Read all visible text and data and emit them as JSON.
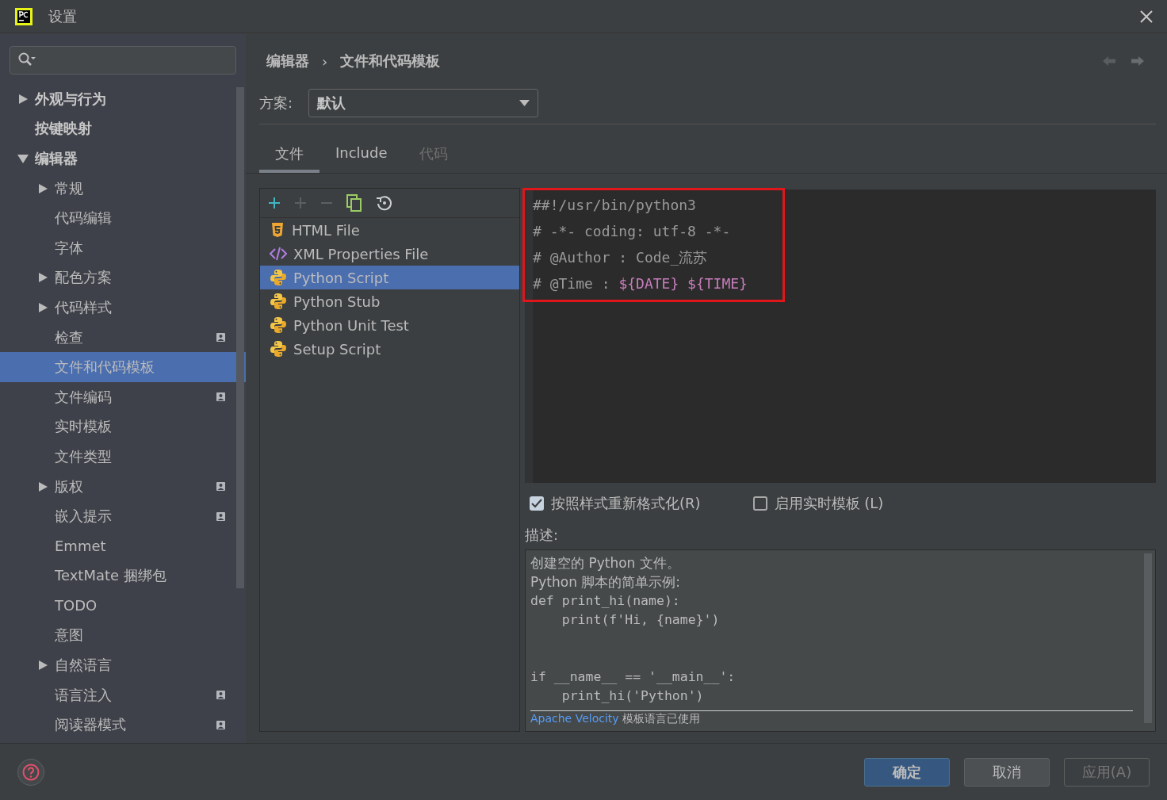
{
  "window": {
    "title": "设置"
  },
  "sidebar": {
    "items": [
      {
        "label": "外观与行为",
        "expanded": false,
        "bold": true,
        "selected": false
      },
      {
        "label": "按键映射",
        "bold": true,
        "selected": false
      },
      {
        "label": "编辑器",
        "expanded": true,
        "bold": true,
        "selected": false,
        "children": [
          {
            "label": "常规",
            "expanded": false,
            "selected": false
          },
          {
            "label": "代码编辑",
            "selected": false
          },
          {
            "label": "字体",
            "selected": false
          },
          {
            "label": "配色方案",
            "expanded": false,
            "selected": false
          },
          {
            "label": "代码样式",
            "expanded": false,
            "selected": false
          },
          {
            "label": "检查",
            "project_level": true,
            "selected": false
          },
          {
            "label": "文件和代码模板",
            "selected": true
          },
          {
            "label": "文件编码",
            "project_level": true,
            "selected": false
          },
          {
            "label": "实时模板",
            "selected": false
          },
          {
            "label": "文件类型",
            "selected": false
          },
          {
            "label": "版权",
            "expanded": false,
            "project_level": true,
            "selected": false
          },
          {
            "label": "嵌入提示",
            "project_level": true,
            "selected": false
          },
          {
            "label": "Emmet",
            "selected": false
          },
          {
            "label": "TextMate 捆绑包",
            "selected": false
          },
          {
            "label": "TODO",
            "selected": false
          },
          {
            "label": "意图",
            "selected": false
          },
          {
            "label": "自然语言",
            "expanded": false,
            "selected": false
          },
          {
            "label": "语言注入",
            "project_level": true,
            "selected": false
          },
          {
            "label": "阅读器模式",
            "project_level": true,
            "selected": false
          }
        ]
      }
    ]
  },
  "breadcrumb": [
    "编辑器",
    "文件和代码模板"
  ],
  "breadcrumb_separator": "›",
  "scheme": {
    "label": "方案:",
    "value": "默认"
  },
  "tabs": [
    {
      "label": "文件",
      "selected": true,
      "disabled": false
    },
    {
      "label": "Include",
      "selected": false,
      "disabled": false
    },
    {
      "label": "代码",
      "selected": false,
      "disabled": true
    }
  ],
  "toolbar": [
    {
      "kind": "add",
      "disabled": false
    },
    {
      "kind": "add",
      "disabled": true
    },
    {
      "kind": "remove",
      "disabled": true
    },
    {
      "kind": "copy",
      "disabled": false
    },
    {
      "kind": "reset",
      "disabled": false
    }
  ],
  "templates": [
    {
      "label": "HTML File",
      "kind": "html",
      "selected": false
    },
    {
      "label": "XML Properties File",
      "kind": "xml",
      "selected": false
    },
    {
      "label": "Python Script",
      "kind": "python",
      "selected": true
    },
    {
      "label": "Python Stub",
      "kind": "python",
      "selected": false
    },
    {
      "label": "Python Unit Test",
      "kind": "python",
      "selected": false
    },
    {
      "label": "Setup Script",
      "kind": "python",
      "selected": false
    }
  ],
  "editor": {
    "lines": [
      {
        "highlighted": true,
        "parts": [
          {
            "text": "##!/usr/bin/python3",
            "kind": "comment"
          }
        ]
      },
      {
        "highlighted": true,
        "parts": [
          {
            "text": "# -*- coding: utf-8 -*-",
            "kind": "comment"
          }
        ]
      },
      {
        "highlighted": true,
        "parts": [
          {
            "text": "# @Author : Code_流苏",
            "kind": "comment"
          }
        ]
      },
      {
        "highlighted": true,
        "parts": [
          {
            "text": "# @Time : ",
            "kind": "comment"
          },
          {
            "text": "${DATE}",
            "kind": "variable"
          },
          {
            "text": " ${TIME}",
            "kind": "variable"
          }
        ]
      }
    ]
  },
  "options": [
    {
      "label": "按照样式重新格式化(R)",
      "checked": true
    },
    {
      "label": "启用实时模板 (L)",
      "checked": false
    }
  ],
  "description": {
    "label": "描述:",
    "lines": [
      {
        "kind": "text",
        "text": "创建空的 Python 文件。"
      },
      {
        "kind": "text",
        "text": "Python 脚本的简单示例:"
      },
      {
        "kind": "code",
        "text": "def print_hi(name):"
      },
      {
        "kind": "code",
        "text": "    print(f'Hi, {name}')"
      },
      {
        "kind": "blank"
      },
      {
        "kind": "blank"
      },
      {
        "kind": "code",
        "text": "if __name__ == '__main__':"
      },
      {
        "kind": "code",
        "text": "    print_hi('Python')"
      }
    ],
    "footer_link": "Apache Velocity",
    "footer_text": "模板语言已使用"
  },
  "buttons": [
    {
      "label": "确定",
      "kind": "primary",
      "disabled": false
    },
    {
      "label": "取消",
      "kind": "normal",
      "disabled": false
    },
    {
      "label": "应用(A)",
      "kind": "normal",
      "disabled": true
    }
  ]
}
